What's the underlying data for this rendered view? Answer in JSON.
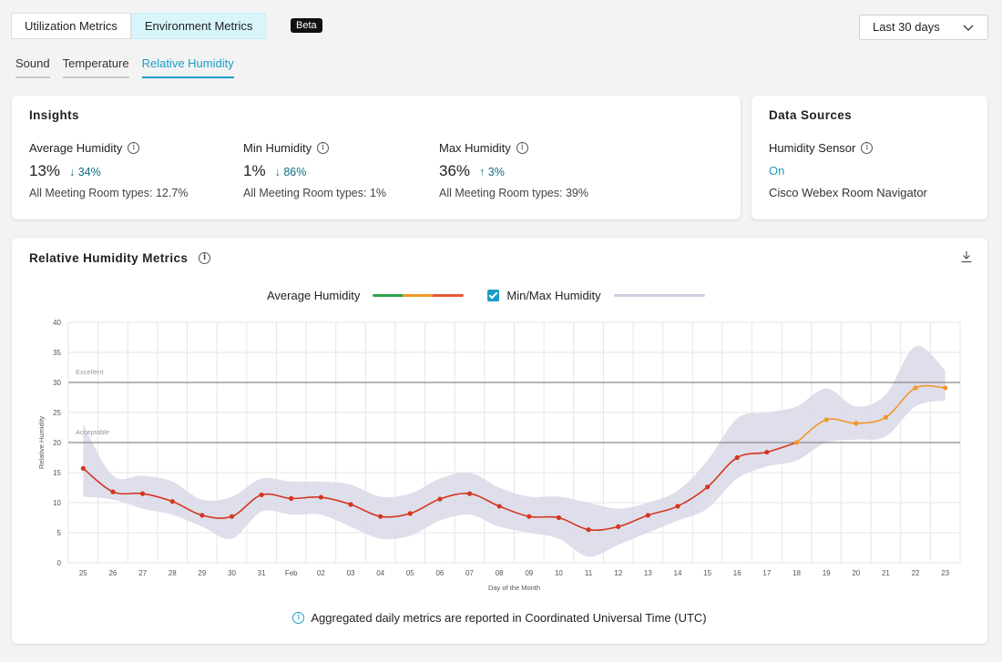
{
  "tabs": [
    {
      "label": "Utilization Metrics",
      "active": false
    },
    {
      "label": "Environment Metrics",
      "active": true
    }
  ],
  "badge": "Beta",
  "date_range": {
    "selected": "Last 30 days"
  },
  "subtabs": [
    {
      "label": "Sound",
      "active": false
    },
    {
      "label": "Temperature",
      "active": false
    },
    {
      "label": "Relative Humidity",
      "active": true
    }
  ],
  "insights": {
    "title": "Insights",
    "items": [
      {
        "label": "Average Humidity",
        "value": "13%",
        "delta": "34%",
        "direction": "down",
        "sub": "All Meeting Room types: 12.7%"
      },
      {
        "label": "Min Humidity",
        "value": "1%",
        "delta": "86%",
        "direction": "down",
        "sub": "All Meeting Room types: 1%"
      },
      {
        "label": "Max Humidity",
        "value": "36%",
        "delta": "3%",
        "direction": "up",
        "sub": "All Meeting Room types: 39%"
      }
    ]
  },
  "data_sources": {
    "title": "Data Sources",
    "sensor_label": "Humidity Sensor",
    "status": "On",
    "device": "Cisco Webex Room Navigator"
  },
  "metrics": {
    "title": "Relative Humidity Metrics",
    "legend": {
      "average_label": "Average Humidity",
      "minmax_label": "Min/Max Humidity",
      "minmax_checked": true
    },
    "footnote": "Aggregated daily metrics are reported in Coordinated Universal Time (UTC)"
  },
  "colors": {
    "accent": "#1d9dc5",
    "avg_red": "#d4361f",
    "avg_orange": "#f0982a",
    "avg_green": "#2aa34a",
    "band": "#d9d8e8"
  },
  "chart_data": {
    "type": "line",
    "xlabel": "Day of the Month",
    "ylabel": "Relative Humidity",
    "ylim": [
      0,
      40
    ],
    "yticks": [
      0,
      5,
      10,
      15,
      20,
      25,
      30,
      35,
      40
    ],
    "categories": [
      "25",
      "26",
      "27",
      "28",
      "29",
      "30",
      "31",
      "Feb",
      "02",
      "03",
      "04",
      "05",
      "06",
      "07",
      "08",
      "09",
      "10",
      "11",
      "12",
      "13",
      "14",
      "15",
      "16",
      "17",
      "18",
      "19",
      "20",
      "21",
      "22",
      "23"
    ],
    "thresholds": [
      {
        "label": "Excellent",
        "value": 30
      },
      {
        "label": "Acceptable",
        "value": 20
      }
    ],
    "series": [
      {
        "name": "Average Humidity",
        "values": [
          15.7,
          11.8,
          11.5,
          10.2,
          7.9,
          7.7,
          11.3,
          10.7,
          10.9,
          9.7,
          7.7,
          8.2,
          10.6,
          11.5,
          9.4,
          7.7,
          7.5,
          5.5,
          6.0,
          7.9,
          9.4,
          12.6,
          17.5,
          18.4,
          20.0,
          23.8,
          23.2,
          24.2,
          29.1,
          29.1
        ]
      },
      {
        "name": "Min/Max Humidity",
        "min": [
          11.0,
          10.5,
          9.0,
          8.0,
          6.0,
          4.0,
          8.5,
          8.0,
          8.0,
          6.0,
          4.0,
          4.5,
          7.0,
          8.0,
          6.0,
          5.0,
          4.0,
          1.0,
          3.0,
          5.0,
          7.0,
          9.0,
          14.0,
          16.0,
          17.0,
          20.0,
          20.5,
          21.0,
          26.0,
          27.0
        ],
        "max": [
          23.0,
          14.5,
          14.5,
          13.5,
          10.5,
          11.0,
          14.0,
          13.5,
          13.5,
          13.0,
          11.0,
          11.5,
          14.0,
          15.0,
          12.5,
          11.0,
          11.0,
          10.0,
          9.0,
          10.0,
          12.0,
          17.0,
          24.0,
          25.0,
          26.0,
          29.0,
          26.0,
          28.0,
          36.0,
          32.0
        ]
      }
    ]
  }
}
